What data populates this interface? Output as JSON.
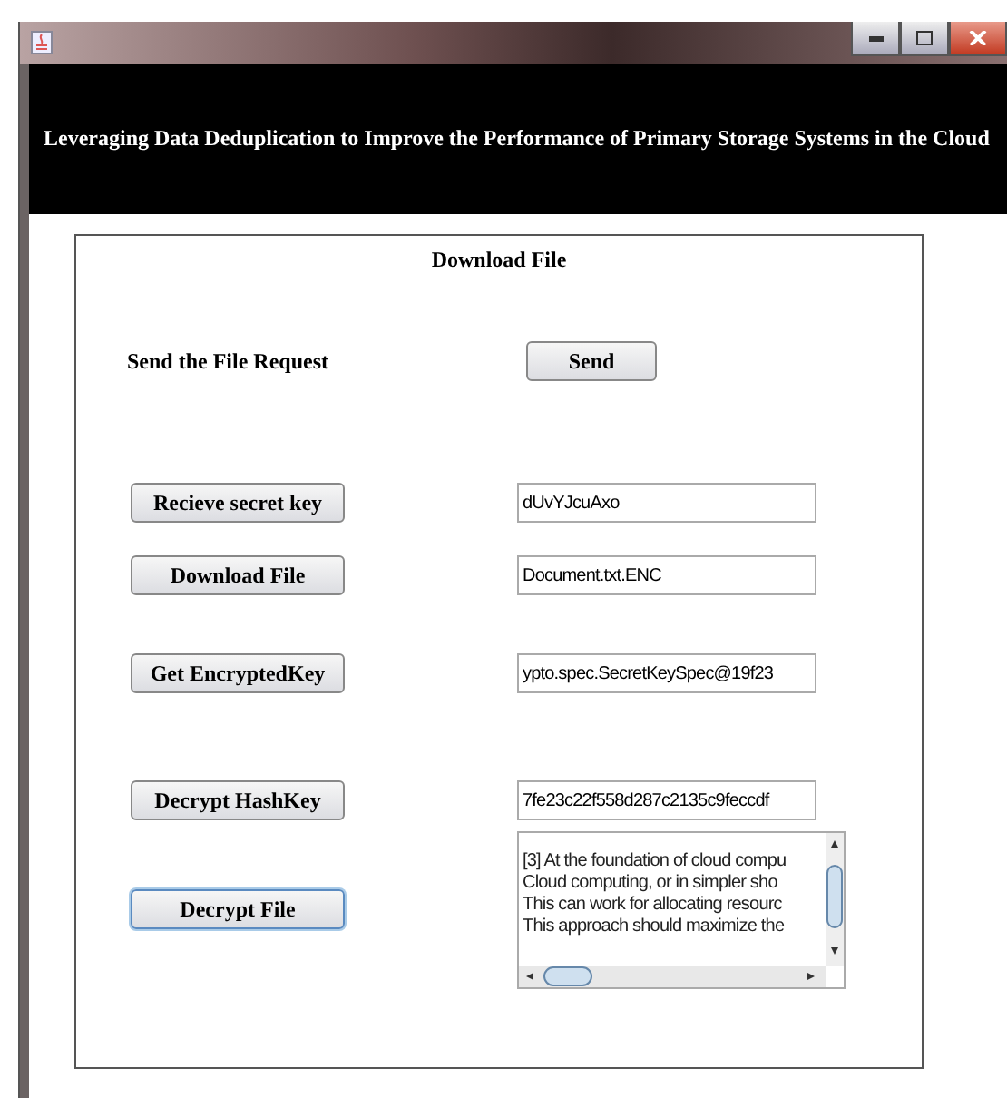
{
  "banner": {
    "title": "Leveraging Data Deduplication to Improve the Performance of Primary Storage Systems in the Cloud"
  },
  "panel": {
    "title": "Download File",
    "rows": [
      {
        "kind": "request",
        "label": "Send the File Request",
        "button": {
          "label": "Send",
          "focused": false
        }
      },
      {
        "kind": "field",
        "button": {
          "label": "Recieve secret key",
          "focused": false
        },
        "value": "dUvYJcuAxo"
      },
      {
        "kind": "field",
        "button": {
          "label": "Download File",
          "focused": false
        },
        "value": "Document.txt.ENC"
      },
      {
        "kind": "field",
        "button": {
          "label": "Get EncryptedKey",
          "focused": false
        },
        "value": "ypto.spec.SecretKeySpec@19f23"
      },
      {
        "kind": "field",
        "button": {
          "label": "Decrypt HashKey",
          "focused": false
        },
        "value": "7fe23c22f558d287c2135c9feccdf"
      },
      {
        "kind": "area",
        "button": {
          "label": "Decrypt File",
          "focused": true
        },
        "lines": [
          "[3] At the foundation of cloud compu",
          "Cloud computing, or in simpler sho",
          "This can work for allocating resourc",
          "This approach should maximize the"
        ]
      }
    ]
  }
}
